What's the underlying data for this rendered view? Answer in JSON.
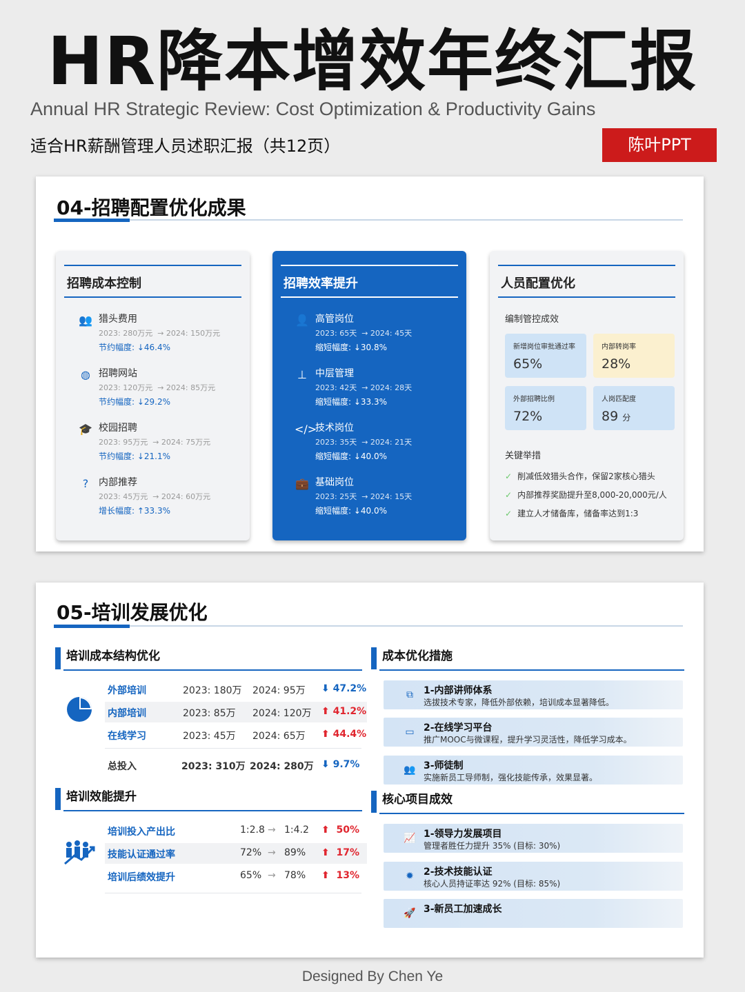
{
  "header": {
    "title": "HR降本增效年终汇报",
    "subtitle_en": "Annual HR Strategic Review: Cost Optimization & Productivity Gains",
    "subtitle_cn": "适合HR薪酬管理人员述职汇报（共12页）",
    "badge": "陈叶PPT"
  },
  "slide1": {
    "title": "04-招聘配置优化成果",
    "panel_left": {
      "title": "招聘成本控制",
      "items": [
        {
          "name": "猎头费用",
          "y2023": "2023: 280万元",
          "y2024": "2024: 150万元",
          "change": "节约幅度: ↓46.4%",
          "icon": "people-icon"
        },
        {
          "name": "招聘网站",
          "y2023": "2023: 120万元",
          "y2024": "2024: 85万元",
          "change": "节约幅度: ↓29.2%",
          "icon": "globe-icon"
        },
        {
          "name": "校园招聘",
          "y2023": "2023: 95万元",
          "y2024": "2024: 75万元",
          "change": "节约幅度: ↓21.1%",
          "icon": "graduation-cap-icon"
        },
        {
          "name": "内部推荐",
          "y2023": "2023: 45万元",
          "y2024": "2024: 60万元",
          "change": "增长幅度: ↑33.3%",
          "icon": "question-circle-icon"
        }
      ]
    },
    "panel_mid": {
      "title": "招聘效率提升",
      "items": [
        {
          "name": "高管岗位",
          "y2023": "2023: 65天",
          "y2024": "2024: 45天",
          "change": "缩短幅度: ↓30.8%",
          "icon": "user-tie-icon"
        },
        {
          "name": "中层管理",
          "y2023": "2023: 42天",
          "y2024": "2024: 28天",
          "change": "缩短幅度: ↓33.3%",
          "icon": "org-chart-icon"
        },
        {
          "name": "技术岗位",
          "y2023": "2023: 35天",
          "y2024": "2024: 21天",
          "change": "缩短幅度: ↓40.0%",
          "icon": "code-icon"
        },
        {
          "name": "基础岗位",
          "y2023": "2023: 25天",
          "y2024": "2024: 15天",
          "change": "缩短幅度: ↓40.0%",
          "icon": "briefcase-icon"
        }
      ]
    },
    "panel_right": {
      "title": "人员配置优化",
      "sub_label": "编制管控成效",
      "stats": [
        {
          "label": "新增岗位审批通过率",
          "value": "65%",
          "bg": "#cfe3f6"
        },
        {
          "label": "内部转岗率",
          "value": "28%",
          "bg": "#fbf0cf"
        },
        {
          "label": "外部招聘比例",
          "value": "72%",
          "bg": "#cfe3f6"
        },
        {
          "label": "人岗匹配度",
          "value": "89",
          "unit": "分",
          "bg": "#cfe3f6"
        }
      ],
      "actions_label": "关键举措",
      "actions": [
        "削减低效猎头合作，保留2家核心猎头",
        "内部推荐奖励提升至8,000-20,000元/人",
        "建立人才储备库，储备率达到1:3"
      ]
    }
  },
  "slide2": {
    "title": "05-培训发展优化",
    "cost_section": {
      "title": "培训成本结构优化",
      "rows": [
        {
          "name": "外部培训",
          "y2023": "2023: 180万",
          "y2024": "2024: 95万",
          "arrow": "⬇",
          "change": "47.2%",
          "dir": "down"
        },
        {
          "name": "内部培训",
          "y2023": "2023: 85万",
          "y2024": "2024: 120万",
          "arrow": "⬆",
          "change": "41.2%",
          "dir": "up"
        },
        {
          "name": "在线学习",
          "y2023": "2023: 45万",
          "y2024": "2024: 65万",
          "arrow": "⬆",
          "change": "44.4%",
          "dir": "up"
        }
      ],
      "total": {
        "name": "总投入",
        "y2023": "2023: 310万",
        "y2024": "2024: 280万",
        "arrow": "⬇",
        "change": "9.7%"
      }
    },
    "efficiency_section": {
      "title": "培训效能提升",
      "rows": [
        {
          "name": "培训投入产出比",
          "from": "1:2.8",
          "to": "1:4.2",
          "change": "50%"
        },
        {
          "name": "技能认证通过率",
          "from": "72%",
          "to": "89%",
          "change": "17%"
        },
        {
          "name": "培训后绩效提升",
          "from": "65%",
          "to": "78%",
          "change": "13%"
        }
      ],
      "arrow": "→",
      "up_arrow": "⬆"
    },
    "measures_section": {
      "title": "成本优化措施",
      "items": [
        {
          "title": "1-内部讲师体系",
          "desc": "选拔技术专家，降低外部依赖，培训成本显著降低。",
          "icon": "presentation-icon"
        },
        {
          "title": "2-在线学习平台",
          "desc": "推广MOOC与微课程，提升学习灵活性，降低学习成本。",
          "icon": "laptop-icon"
        },
        {
          "title": "3-师徒制",
          "desc": "实施新员工导师制，强化技能传承，效果显著。",
          "icon": "users-icon"
        }
      ]
    },
    "projects_section": {
      "title": "核心项目成效",
      "items": [
        {
          "title": "1-领导力发展项目",
          "desc": "管理者胜任力提升 35% (目标: 30%)",
          "icon": "line-chart-icon"
        },
        {
          "title": "2-技术技能认证",
          "desc": "核心人员持证率达 92% (目标: 85%)",
          "icon": "gear-icon"
        },
        {
          "title": "3-新员工加速成长",
          "desc": "",
          "icon": "rocket-icon"
        }
      ]
    }
  },
  "footer": "Designed By Chen Ye",
  "colors": {
    "accent": "#1565c0",
    "red": "#e0262f",
    "badge": "#cc1b1b"
  }
}
